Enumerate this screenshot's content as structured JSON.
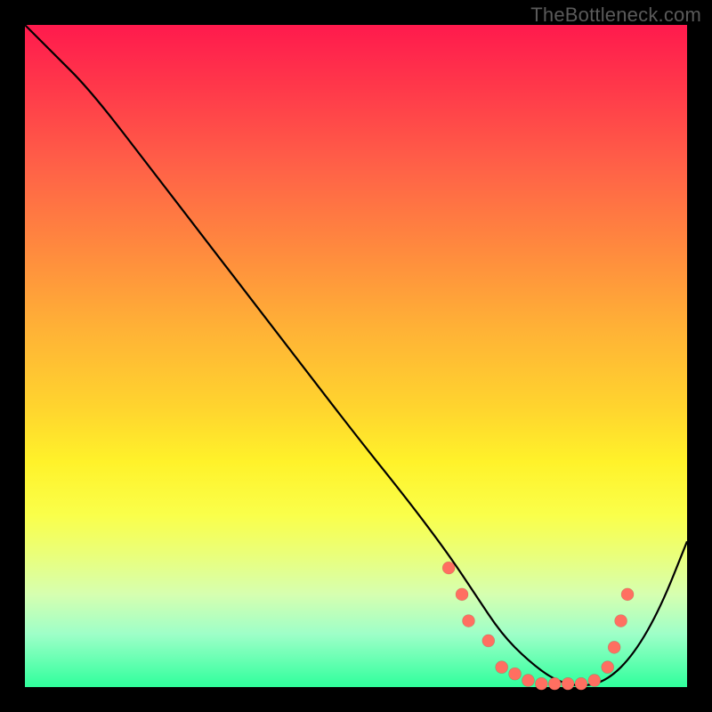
{
  "watermark": "TheBottleneck.com",
  "chart_data": {
    "type": "line",
    "title": "",
    "xlabel": "",
    "ylabel": "",
    "xlim": [
      0,
      100
    ],
    "ylim": [
      0,
      100
    ],
    "grid": false,
    "legend": false,
    "series": [
      {
        "name": "curve",
        "x": [
          0,
          4,
          10,
          20,
          30,
          40,
          50,
          58,
          64,
          68,
          72,
          76,
          80,
          84,
          88,
          92,
          96,
          100
        ],
        "y": [
          100,
          96,
          90,
          77,
          64,
          51,
          38,
          28,
          20,
          14,
          8,
          4,
          1,
          0,
          1,
          5,
          12,
          22
        ]
      }
    ],
    "markers": [
      {
        "x": 64,
        "y": 18
      },
      {
        "x": 66,
        "y": 14
      },
      {
        "x": 67,
        "y": 10
      },
      {
        "x": 70,
        "y": 7
      },
      {
        "x": 72,
        "y": 3
      },
      {
        "x": 74,
        "y": 2
      },
      {
        "x": 76,
        "y": 1
      },
      {
        "x": 78,
        "y": 0.5
      },
      {
        "x": 80,
        "y": 0.5
      },
      {
        "x": 82,
        "y": 0.5
      },
      {
        "x": 84,
        "y": 0.5
      },
      {
        "x": 86,
        "y": 1
      },
      {
        "x": 88,
        "y": 3
      },
      {
        "x": 89,
        "y": 6
      },
      {
        "x": 90,
        "y": 10
      },
      {
        "x": 91,
        "y": 14
      }
    ]
  }
}
